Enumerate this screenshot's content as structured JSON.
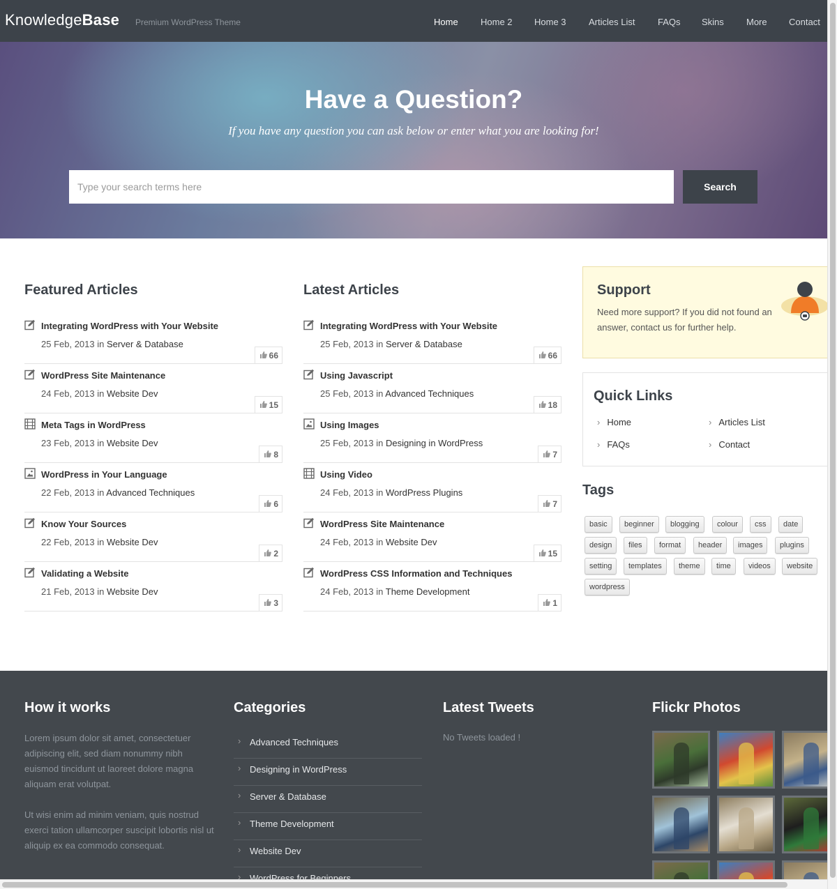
{
  "header": {
    "logo_light": "Knowledge",
    "logo_bold": "Base",
    "tagline": "Premium WordPress Theme",
    "nav": [
      "Home",
      "Home 2",
      "Home 3",
      "Articles List",
      "FAQs",
      "Skins",
      "More",
      "Contact"
    ]
  },
  "hero": {
    "title": "Have a Question?",
    "subtitle": "If you have any question you can ask below or enter what you are looking for!",
    "search_placeholder": "Type your search terms here",
    "search_button": "Search"
  },
  "featured": {
    "title": "Featured Articles",
    "items": [
      {
        "title": "Integrating WordPress with Your Website",
        "date": "25 Feb, 2013",
        "in": "in",
        "category": "Server & Database",
        "likes": "66",
        "icon": "edit-icon"
      },
      {
        "title": "WordPress Site Maintenance",
        "date": "24 Feb, 2013",
        "in": "in",
        "category": "Website Dev",
        "likes": "15",
        "icon": "edit-icon"
      },
      {
        "title": "Meta Tags in WordPress",
        "date": "23 Feb, 2013",
        "in": "in",
        "category": "Website Dev",
        "likes": "8",
        "icon": "film-icon"
      },
      {
        "title": "WordPress in Your Language",
        "date": "22 Feb, 2013",
        "in": "in",
        "category": "Advanced Techniques",
        "likes": "6",
        "icon": "image-icon"
      },
      {
        "title": "Know Your Sources",
        "date": "22 Feb, 2013",
        "in": "in",
        "category": "Website Dev",
        "likes": "2",
        "icon": "edit-icon"
      },
      {
        "title": "Validating a Website",
        "date": "21 Feb, 2013",
        "in": "in",
        "category": "Website Dev",
        "likes": "3",
        "icon": "edit-icon"
      }
    ]
  },
  "latest": {
    "title": "Latest Articles",
    "items": [
      {
        "title": "Integrating WordPress with Your Website",
        "date": "25 Feb, 2013",
        "in": "in",
        "category": "Server & Database",
        "likes": "66",
        "icon": "edit-icon"
      },
      {
        "title": "Using Javascript",
        "date": "25 Feb, 2013",
        "in": "in",
        "category": "Advanced Techniques",
        "likes": "18",
        "icon": "edit-icon"
      },
      {
        "title": "Using Images",
        "date": "25 Feb, 2013",
        "in": "in",
        "category": "Designing in WordPress",
        "likes": "7",
        "icon": "image-icon"
      },
      {
        "title": "Using Video",
        "date": "24 Feb, 2013",
        "in": "in",
        "category": "WordPress Plugins",
        "likes": "7",
        "icon": "film-icon"
      },
      {
        "title": "WordPress Site Maintenance",
        "date": "24 Feb, 2013",
        "in": "in",
        "category": "Website Dev",
        "likes": "15",
        "icon": "edit-icon"
      },
      {
        "title": "WordPress CSS Information and Techniques",
        "date": "24 Feb, 2013",
        "in": "in",
        "category": "Theme Development",
        "likes": "1",
        "icon": "edit-icon"
      }
    ]
  },
  "support": {
    "title": "Support",
    "text": "Need more support? If you did not found an answer, contact us for further help."
  },
  "quick_links": {
    "title": "Quick Links",
    "items": [
      "Home",
      "Articles List",
      "FAQs",
      "Contact"
    ]
  },
  "tags": {
    "title": "Tags",
    "items": [
      "basic",
      "beginner",
      "blogging",
      "colour",
      "css",
      "date",
      "design",
      "files",
      "format",
      "header",
      "images",
      "plugins",
      "setting",
      "templates",
      "theme",
      "time",
      "videos",
      "website",
      "wordpress"
    ]
  },
  "footer": {
    "how_title": "How it works",
    "how_p1": "Lorem ipsum dolor sit amet, consectetuer adipiscing elit, sed diam nonummy nibh euismod tincidunt ut laoreet dolore magna aliquam erat volutpat.",
    "how_p2": "Ut wisi enim ad minim veniam, quis nostrud exerci tation ullamcorper suscipit lobortis nisl ut aliquip ex ea commodo consequat.",
    "cat_title": "Categories",
    "categories": [
      "Advanced Techniques",
      "Designing in WordPress",
      "Server & Database",
      "Theme Development",
      "Website Dev",
      "WordPress for Beginners"
    ],
    "tweets_title": "Latest Tweets",
    "tweets_text": "No Tweets loaded !",
    "flickr_title": "Flickr Photos"
  },
  "colors": {
    "dark": "#3d434a",
    "support_bg": "#fffbe0",
    "footer_bg": "#43484d",
    "accent_orange": "#f07c28"
  }
}
